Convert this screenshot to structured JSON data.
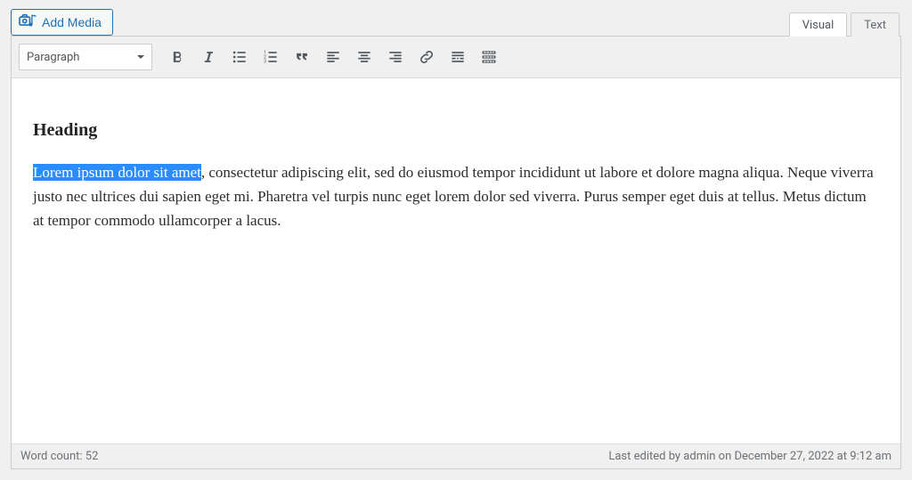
{
  "add_media_label": "Add Media",
  "tabs": {
    "visual": "Visual",
    "text": "Text"
  },
  "format_select": "Paragraph",
  "content": {
    "heading": "Heading",
    "selected_text": "Lorem ipsum dolor sit amet",
    "body_rest": ", consectetur adipiscing elit, sed do eiusmod tempor incididunt ut labore et dolore magna aliqua. Neque viverra justo nec ultrices dui sapien eget mi. Pharetra vel turpis nunc eget lorem dolor sed viverra. Purus semper eget duis at tellus. Metus dictum at tempor commodo ullamcorper a lacus."
  },
  "status": {
    "word_count": "Word count: 52",
    "last_edited": "Last edited by admin on December 27, 2022 at 9:12 am"
  },
  "colors": {
    "accent": "#2271b1",
    "selection": "#2a8cff"
  }
}
